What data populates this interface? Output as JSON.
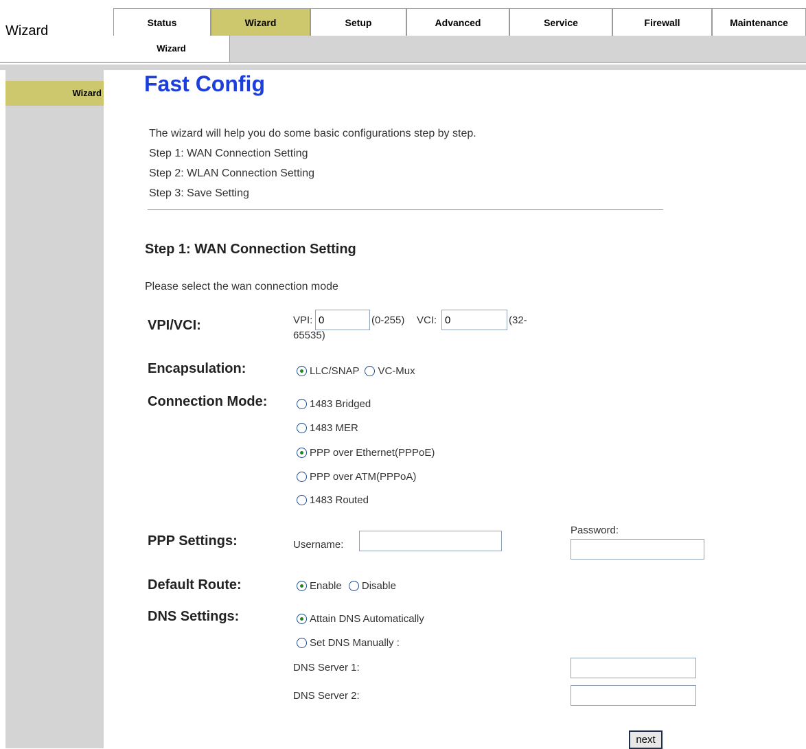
{
  "header": {
    "page_heading": "Wizard"
  },
  "nav": {
    "tabs": [
      "Status",
      "Wizard",
      "Setup",
      "Advanced",
      "Service",
      "Firewall",
      "Maintenance"
    ],
    "active": "Wizard",
    "subnav": [
      "Wizard"
    ]
  },
  "sidebar": {
    "items": [
      "Wizard"
    ]
  },
  "main": {
    "title": "Fast Config",
    "intro": [
      "The wizard will help you do some basic configurations step by step.",
      "Step 1: WAN Connection Setting",
      "Step 2: WLAN Connection Setting",
      "Step 3: Save Setting"
    ],
    "step_heading": "Step 1: WAN Connection Setting",
    "instruction": "Please select the wan connection mode",
    "vpi_vci": {
      "label": "VPI/VCI:",
      "vpi_label": "VPI:",
      "vpi_value": "0",
      "vpi_range": "(0-255)",
      "vci_label": "VCI:",
      "vci_value": "0",
      "vci_range_1": "(32-",
      "vci_range_2": "65535)"
    },
    "encapsulation": {
      "label": "Encapsulation:",
      "options": [
        "LLC/SNAP",
        "VC-Mux"
      ],
      "selected": "LLC/SNAP"
    },
    "connection_mode": {
      "label": "Connection Mode:",
      "options": [
        "1483 Bridged",
        "1483 MER",
        "PPP over Ethernet(PPPoE)",
        "PPP over ATM(PPPoA)",
        "1483 Routed"
      ],
      "selected": "PPP over Ethernet(PPPoE)"
    },
    "ppp_settings": {
      "label": "PPP Settings:",
      "username_label": "Username:",
      "username_value": "",
      "password_label": "Password:",
      "password_value": ""
    },
    "default_route": {
      "label": "Default Route:",
      "options": [
        "Enable",
        "Disable"
      ],
      "selected": "Enable"
    },
    "dns_settings": {
      "label": "DNS Settings:",
      "options": [
        "Attain DNS Automatically",
        "Set DNS Manually :"
      ],
      "selected": "Attain DNS Automatically",
      "server1_label": "DNS Server 1:",
      "server1_value": "",
      "server2_label": "DNS Server 2:",
      "server2_value": ""
    },
    "next_label": "next"
  },
  "colors": {
    "accent": "#cdc86e",
    "title_blue": "#1c3edb",
    "panel_gray": "#d4d4d4"
  }
}
